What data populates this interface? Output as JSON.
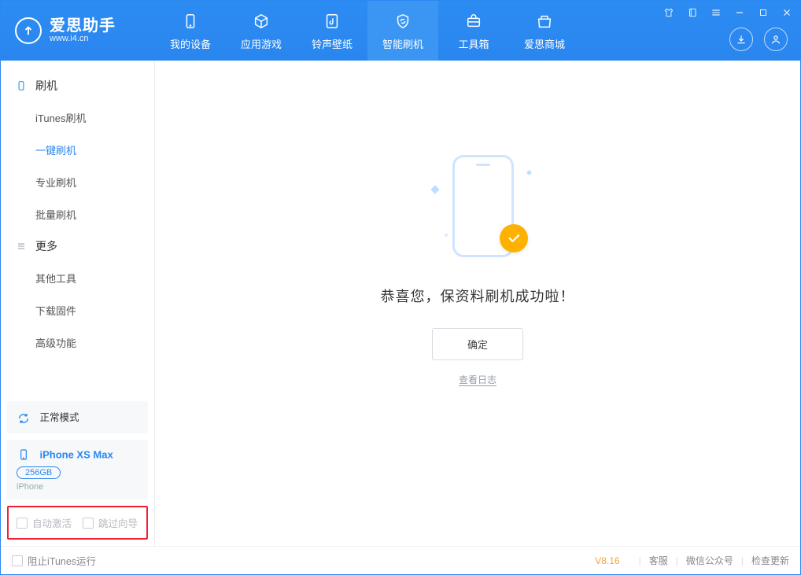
{
  "app": {
    "name_cn": "爱思助手",
    "name_en": "www.i4.cn"
  },
  "nav": {
    "items": [
      {
        "label": "我的设备"
      },
      {
        "label": "应用游戏"
      },
      {
        "label": "铃声壁纸"
      },
      {
        "label": "智能刷机"
      },
      {
        "label": "工具箱"
      },
      {
        "label": "爱思商城"
      }
    ],
    "active_index": 3
  },
  "sidebar": {
    "sections": [
      {
        "title": "刷机",
        "items": [
          "iTunes刷机",
          "一键刷机",
          "专业刷机",
          "批量刷机"
        ],
        "active_index": 1
      },
      {
        "title": "更多",
        "items": [
          "其他工具",
          "下载固件",
          "高级功能"
        ],
        "active_index": -1
      }
    ],
    "mode_card": {
      "label": "正常模式"
    },
    "device_card": {
      "name": "iPhone XS Max",
      "capacity": "256GB",
      "type": "iPhone"
    },
    "options": {
      "auto_activate": "自动激活",
      "skip_guide": "跳过向导"
    }
  },
  "main": {
    "message": "恭喜您，保资料刷机成功啦！",
    "confirm": "确定",
    "view_log": "查看日志"
  },
  "statusbar": {
    "block_itunes": "阻止iTunes运行",
    "version": "V8.16",
    "links": [
      "客服",
      "微信公众号",
      "检查更新"
    ]
  },
  "colors": {
    "primary": "#2a86ef"
  }
}
